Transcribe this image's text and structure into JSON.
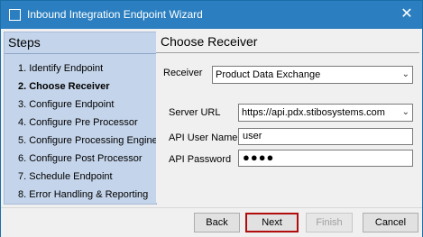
{
  "window": {
    "title": "Inbound Integration Endpoint Wizard",
    "close_symbol": "✕"
  },
  "steps": {
    "title": "Steps",
    "items": [
      {
        "label": "1. Identify Endpoint"
      },
      {
        "label": "2. Choose Receiver"
      },
      {
        "label": "3. Configure Endpoint"
      },
      {
        "label": "4. Configure Pre Processor"
      },
      {
        "label": "5. Configure Processing Engine"
      },
      {
        "label": "6. Configure Post Processor"
      },
      {
        "label": "7. Schedule Endpoint"
      },
      {
        "label": "8. Error Handling & Reporting"
      }
    ],
    "active_index": 1
  },
  "main": {
    "title": "Choose Receiver",
    "receiver": {
      "label": "Receiver",
      "value": "Product Data Exchange"
    },
    "server_url": {
      "label": "Server URL",
      "value": "https://api.pdx.stibosystems.com"
    },
    "api_user": {
      "label": "API User Name",
      "value": "user"
    },
    "api_password": {
      "label": "API Password",
      "value": "●●●●"
    }
  },
  "buttons": {
    "back": "Back",
    "next": "Next",
    "finish": "Finish",
    "cancel": "Cancel"
  },
  "colors": {
    "titlebar": "#2b7fc0",
    "steps_panel": "#c4d4ea",
    "next_highlight": "#b10d0d"
  }
}
